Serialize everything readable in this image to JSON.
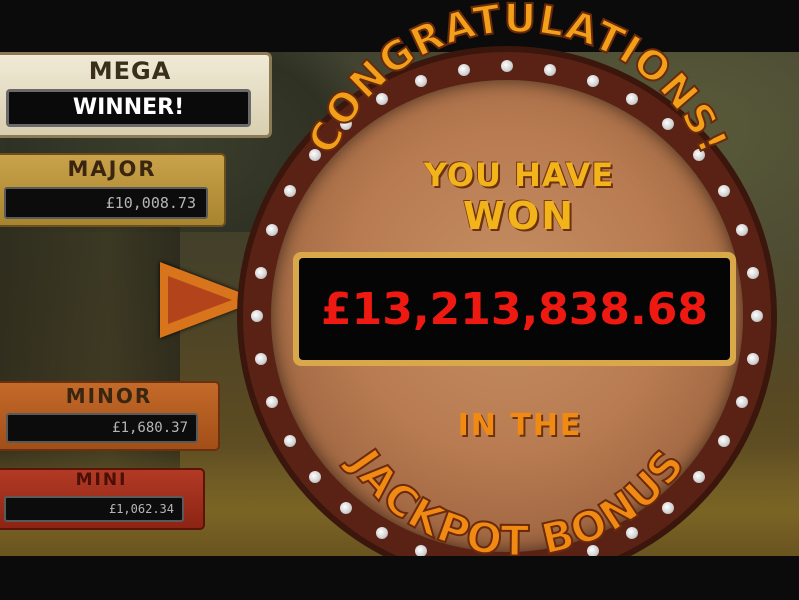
{
  "jackpots": {
    "mega": {
      "title": "MEGA",
      "value": "WINNER!"
    },
    "major": {
      "title": "MAJOR",
      "amount": "£10,008.73"
    },
    "minor": {
      "title": "MINOR",
      "amount": "£1,680.37"
    },
    "mini": {
      "title": "MINI",
      "amount": "£1,062.34"
    }
  },
  "wheel": {
    "headline": "CONGRATULATIONS!",
    "line1": "YOU HAVE",
    "line2": "WON",
    "win_amount": "£13,213,838.68",
    "line3": "IN THE",
    "footer": "JACKPOT BONUS"
  },
  "colors": {
    "win_amount": "#ee1a12",
    "headline": "#f2a01a",
    "pointer": "#d8741c"
  },
  "icons": {
    "pointer": "triangle-pointer-icon"
  }
}
